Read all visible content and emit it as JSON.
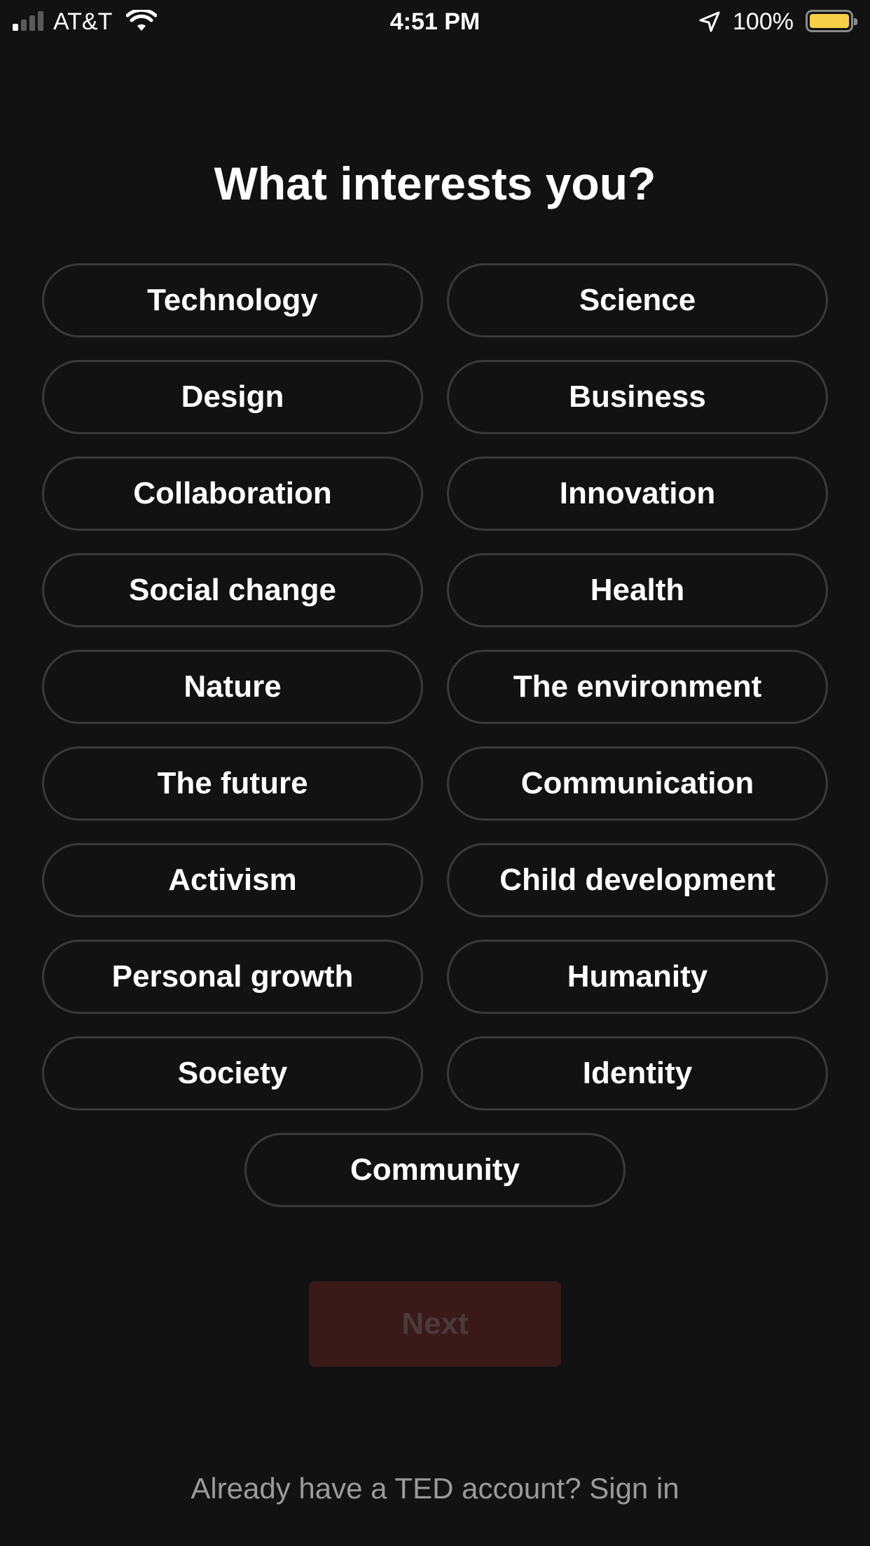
{
  "status_bar": {
    "carrier": "AT&T",
    "time": "4:51 PM",
    "battery_percent": "100%",
    "battery_color": "#f7cf46"
  },
  "heading": "What interests you?",
  "topics": [
    "Technology",
    "Science",
    "Design",
    "Business",
    "Collaboration",
    "Innovation",
    "Social change",
    "Health",
    "Nature",
    "The environment",
    "The future",
    "Communication",
    "Activism",
    "Child development",
    "Personal growth",
    "Humanity",
    "Society",
    "Identity",
    "Community"
  ],
  "next_label": "Next",
  "signin_text": "Already have a TED account? Sign in"
}
